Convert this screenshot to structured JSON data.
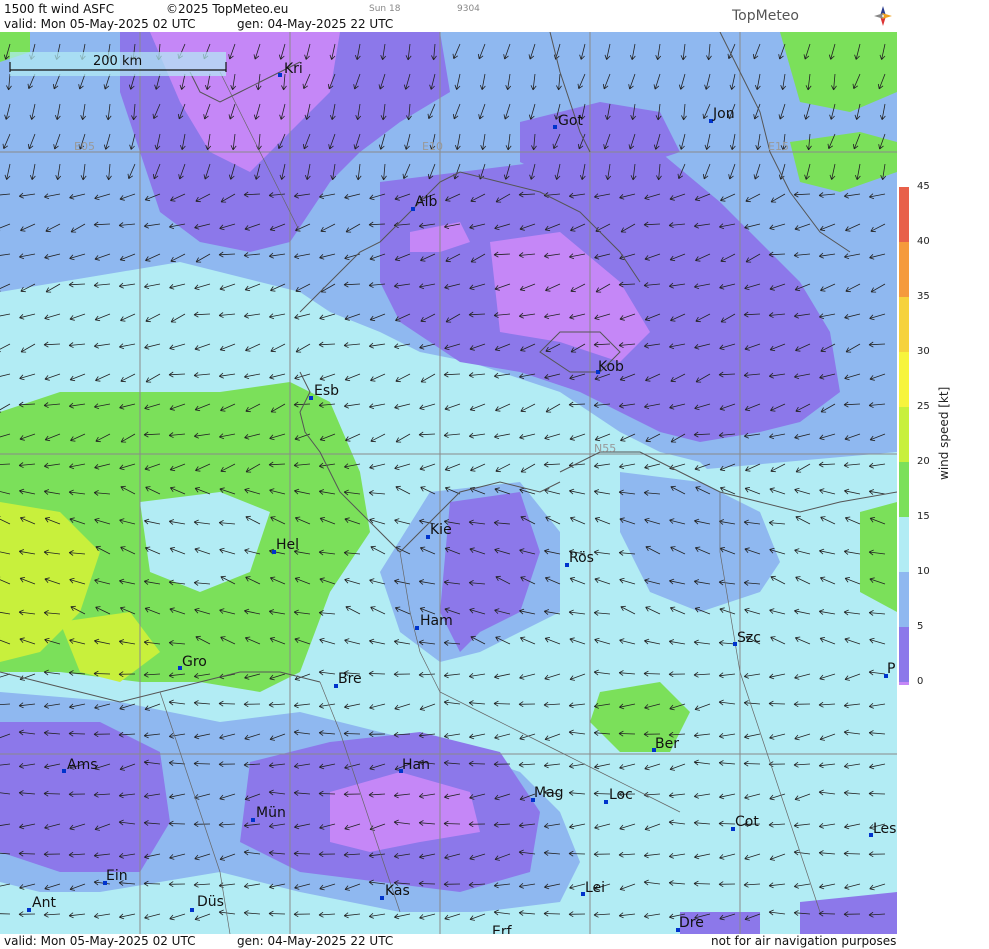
{
  "header": {
    "product": "1500 ft wind ASFC",
    "copyright": "©2025 TopMeteo.eu",
    "valid": "valid:  Mon  05-May-2025  02 UTC",
    "gen": "gen: 04-May-2025 22 UTC",
    "sun": "Sun 18",
    "code": "9304",
    "brand": "TopMeteo"
  },
  "footer": {
    "valid": "valid:  Mon  05-May-2025  02 UTC",
    "gen": "gen: 04-May-2025 22 UTC",
    "disclaimer": "not for air navigation purposes"
  },
  "scale_bar": {
    "label": "200 km"
  },
  "grid_labels": [
    {
      "text": "E05"
    },
    {
      "text": "E10"
    },
    {
      "text": "E15"
    },
    {
      "text": "N55"
    }
  ],
  "cities": [
    {
      "name": "Kri"
    },
    {
      "name": "Got"
    },
    {
      "name": "Jon"
    },
    {
      "name": "Alb"
    },
    {
      "name": "Kob"
    },
    {
      "name": "Esb"
    },
    {
      "name": "Kie"
    },
    {
      "name": "Rös"
    },
    {
      "name": "Hel"
    },
    {
      "name": "Ham"
    },
    {
      "name": "Szc"
    },
    {
      "name": "Gro"
    },
    {
      "name": "Bre"
    },
    {
      "name": "P"
    },
    {
      "name": "Ber"
    },
    {
      "name": "Ams"
    },
    {
      "name": "Han"
    },
    {
      "name": "Mag"
    },
    {
      "name": "Loc"
    },
    {
      "name": "Mün"
    },
    {
      "name": "Cot"
    },
    {
      "name": "Les"
    },
    {
      "name": "Ein"
    },
    {
      "name": "Kas"
    },
    {
      "name": "Lei"
    },
    {
      "name": "Ant"
    },
    {
      "name": "Düs"
    },
    {
      "name": "Dre"
    },
    {
      "name": "Erf"
    }
  ],
  "colorbar": {
    "title": "wind speed [kt]",
    "ticks": [
      "45",
      "40",
      "35",
      "30",
      "25",
      "20",
      "15",
      "10",
      "5",
      "0"
    ],
    "colors": [
      "#e8604a",
      "#f59a3c",
      "#f6d23c",
      "#f7f43c",
      "#c8f03c",
      "#7be05a",
      "#b2ecf4",
      "#8fb8f0",
      "#8c78ea",
      "#c587f7"
    ]
  },
  "legend_colors": {
    "calm": "#c587f7",
    "light": "#8c78ea",
    "moderate": "#8fb8f0",
    "fresh": "#b2ecf4",
    "strong": "#7be05a",
    "stronger": "#c8f03c"
  }
}
